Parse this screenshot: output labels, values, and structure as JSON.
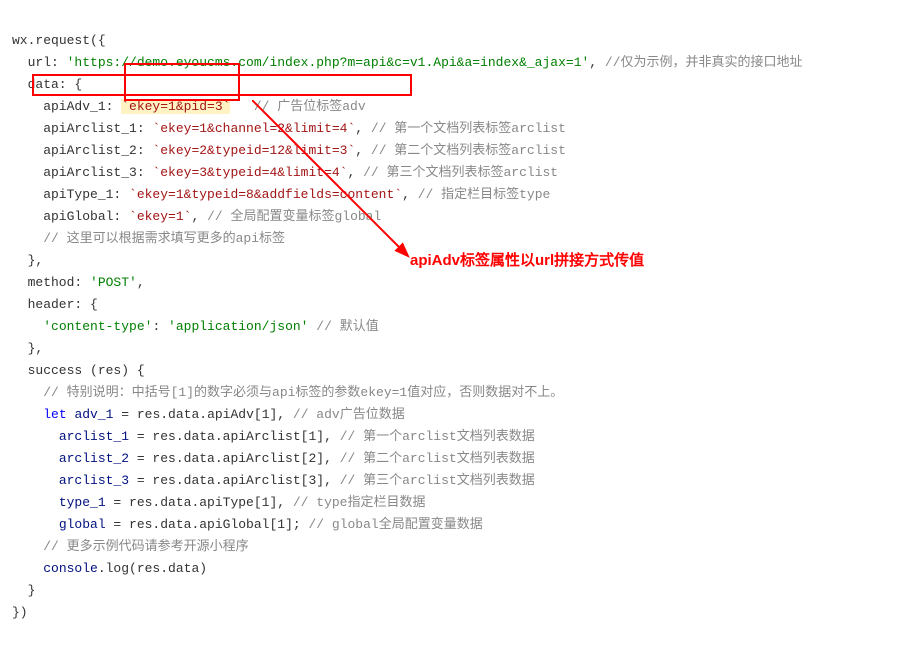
{
  "code": {
    "l1_a": "wx",
    "l1_b": ".request({",
    "l2_a": "  url: ",
    "l2_b": "'https://demo.eyoucms.com/index.php?m=api&c=v1.Api&a=index&_ajax=1'",
    "l2_c": ", ",
    "l2_d": "//仅为示例，并非真实的接口地址",
    "l3": "  data: {",
    "l4_a": "    apiAdv_1: ",
    "l4_b": "`ekey=1&pid=3`",
    "l4_c": "   // 广告位标签adv",
    "l5_a": "    apiArclist_1: ",
    "l5_b": "`ekey=1&channel=2&limit=4`",
    "l5_c": ", ",
    "l5_d": "// 第一个文档列表标签arclist",
    "l6_a": "    apiArclist_2: ",
    "l6_b": "`ekey=2&typeid=12&limit=3`",
    "l6_c": ", ",
    "l6_d": "// 第二个文档列表标签arclist",
    "l7_a": "    apiArclist_3: ",
    "l7_b": "`ekey=3&typeid=4&limit=4`",
    "l7_c": ", ",
    "l7_d": "// 第三个文档列表标签arclist",
    "l8_a": "    apiType_1: ",
    "l8_b": "`ekey=1&typeid=8&addfields=content`",
    "l8_c": ", ",
    "l8_d": "// 指定栏目标签type",
    "l9_a": "    apiGlobal: ",
    "l9_b": "`ekey=1`",
    "l9_c": ", ",
    "l9_d": "// 全局配置变量标签global",
    "l10": "    // 这里可以根据需求填写更多的api标签",
    "l11": "  },",
    "l12_a": "  method: ",
    "l12_b": "'POST'",
    "l12_c": ",",
    "l13": "  header: {",
    "l14_a": "    ",
    "l14_b": "'content-type'",
    "l14_c": ": ",
    "l14_d": "'application/json'",
    "l14_e": " ",
    "l14_f": "// 默认值",
    "l15": "  },",
    "l16": "  success (res) {",
    "l17": "    // 特别说明：中括号[1]的数字必须与api标签的参数ekey=1值对应，否则数据对不上。",
    "l18_a": "    ",
    "l18_b": "let",
    "l18_c": " ",
    "l18_d": "adv_1",
    "l18_e": " = res.data.apiAdv[",
    "l18_f": "1",
    "l18_g": "], ",
    "l18_h": "// adv广告位数据",
    "l19_a": "      ",
    "l19_b": "arclist_1",
    "l19_c": " = res.data.apiArclist[",
    "l19_d": "1",
    "l19_e": "], ",
    "l19_f": "// 第一个arclist文档列表数据",
    "l20_a": "      ",
    "l20_b": "arclist_2",
    "l20_c": " = res.data.apiArclist[",
    "l20_d": "2",
    "l20_e": "], ",
    "l20_f": "// 第二个arclist文档列表数据",
    "l21_a": "      ",
    "l21_b": "arclist_3",
    "l21_c": " = res.data.apiArclist[",
    "l21_d": "3",
    "l21_e": "], ",
    "l21_f": "// 第三个arclist文档列表数据",
    "l22_a": "      ",
    "l22_b": "type_1",
    "l22_c": " = res.data.apiType[",
    "l22_d": "1",
    "l22_e": "], ",
    "l22_f": "// type指定栏目数据",
    "l23_a": "      ",
    "l23_b": "global",
    "l23_c": " = res.data.apiGlobal[",
    "l23_d": "1",
    "l23_e": "]; ",
    "l23_f": "// global全局配置变量数据",
    "l24": "    // 更多示例代码请参考开源小程序",
    "l25_a": "    ",
    "l25_b": "console",
    "l25_c": ".log(res.data)",
    "l26": "  }",
    "l27": "})"
  },
  "annotation": {
    "text": "apiAdv标签属性以url拼接方式传值"
  },
  "colors": {
    "highlight_red": "#ff0000"
  }
}
